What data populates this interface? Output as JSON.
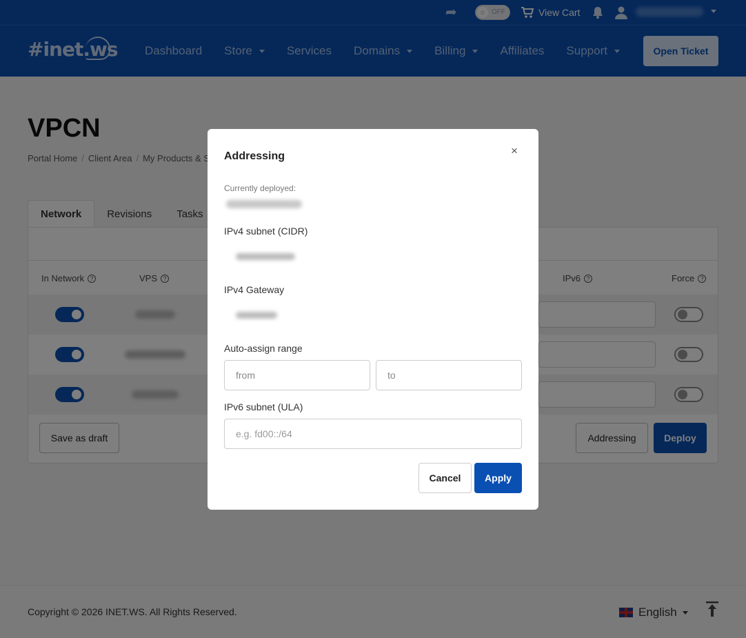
{
  "topbar": {
    "toggle_text": "OFF",
    "view_cart": "View Cart"
  },
  "brand": {
    "logo_text": "#inet.ws"
  },
  "nav": {
    "items": [
      {
        "label": "Dashboard"
      },
      {
        "label": "Store"
      },
      {
        "label": "Services"
      },
      {
        "label": "Domains"
      },
      {
        "label": "Billing"
      },
      {
        "label": "Affiliates"
      },
      {
        "label": "Support"
      }
    ],
    "open_ticket": "Open Ticket"
  },
  "page": {
    "title": "VPCN",
    "breadcrumb": [
      "Portal Home",
      "Client Area",
      "My Products & Services"
    ],
    "tabs": [
      "Network",
      "Revisions",
      "Tasks"
    ],
    "columns": {
      "in_network": "In Network",
      "vps": "VPS",
      "ipv6": "IPv6",
      "force": "Force"
    },
    "buttons": {
      "save_draft": "Save as draft",
      "addressing": "Addressing",
      "deploy": "Deploy"
    }
  },
  "modal": {
    "title": "Addressing",
    "close": "×",
    "currently_deployed_label": "Currently deployed:",
    "ipv4_subnet_label": "IPv4 subnet (CIDR)",
    "ipv4_gateway_label": "IPv4 Gateway",
    "auto_assign_label": "Auto-assign range",
    "from_placeholder": "from",
    "to_placeholder": "to",
    "ipv6_label": "IPv6 subnet (ULA)",
    "ipv6_placeholder": "e.g. fd00::/64",
    "cancel": "Cancel",
    "apply": "Apply"
  },
  "footer": {
    "copyright": "Copyright © 2026 INET.WS. All Rights Reserved.",
    "language": "English"
  },
  "colors": {
    "brand_blue": "#0a50b3",
    "overlay": "rgba(0,0,0,0.5)"
  }
}
